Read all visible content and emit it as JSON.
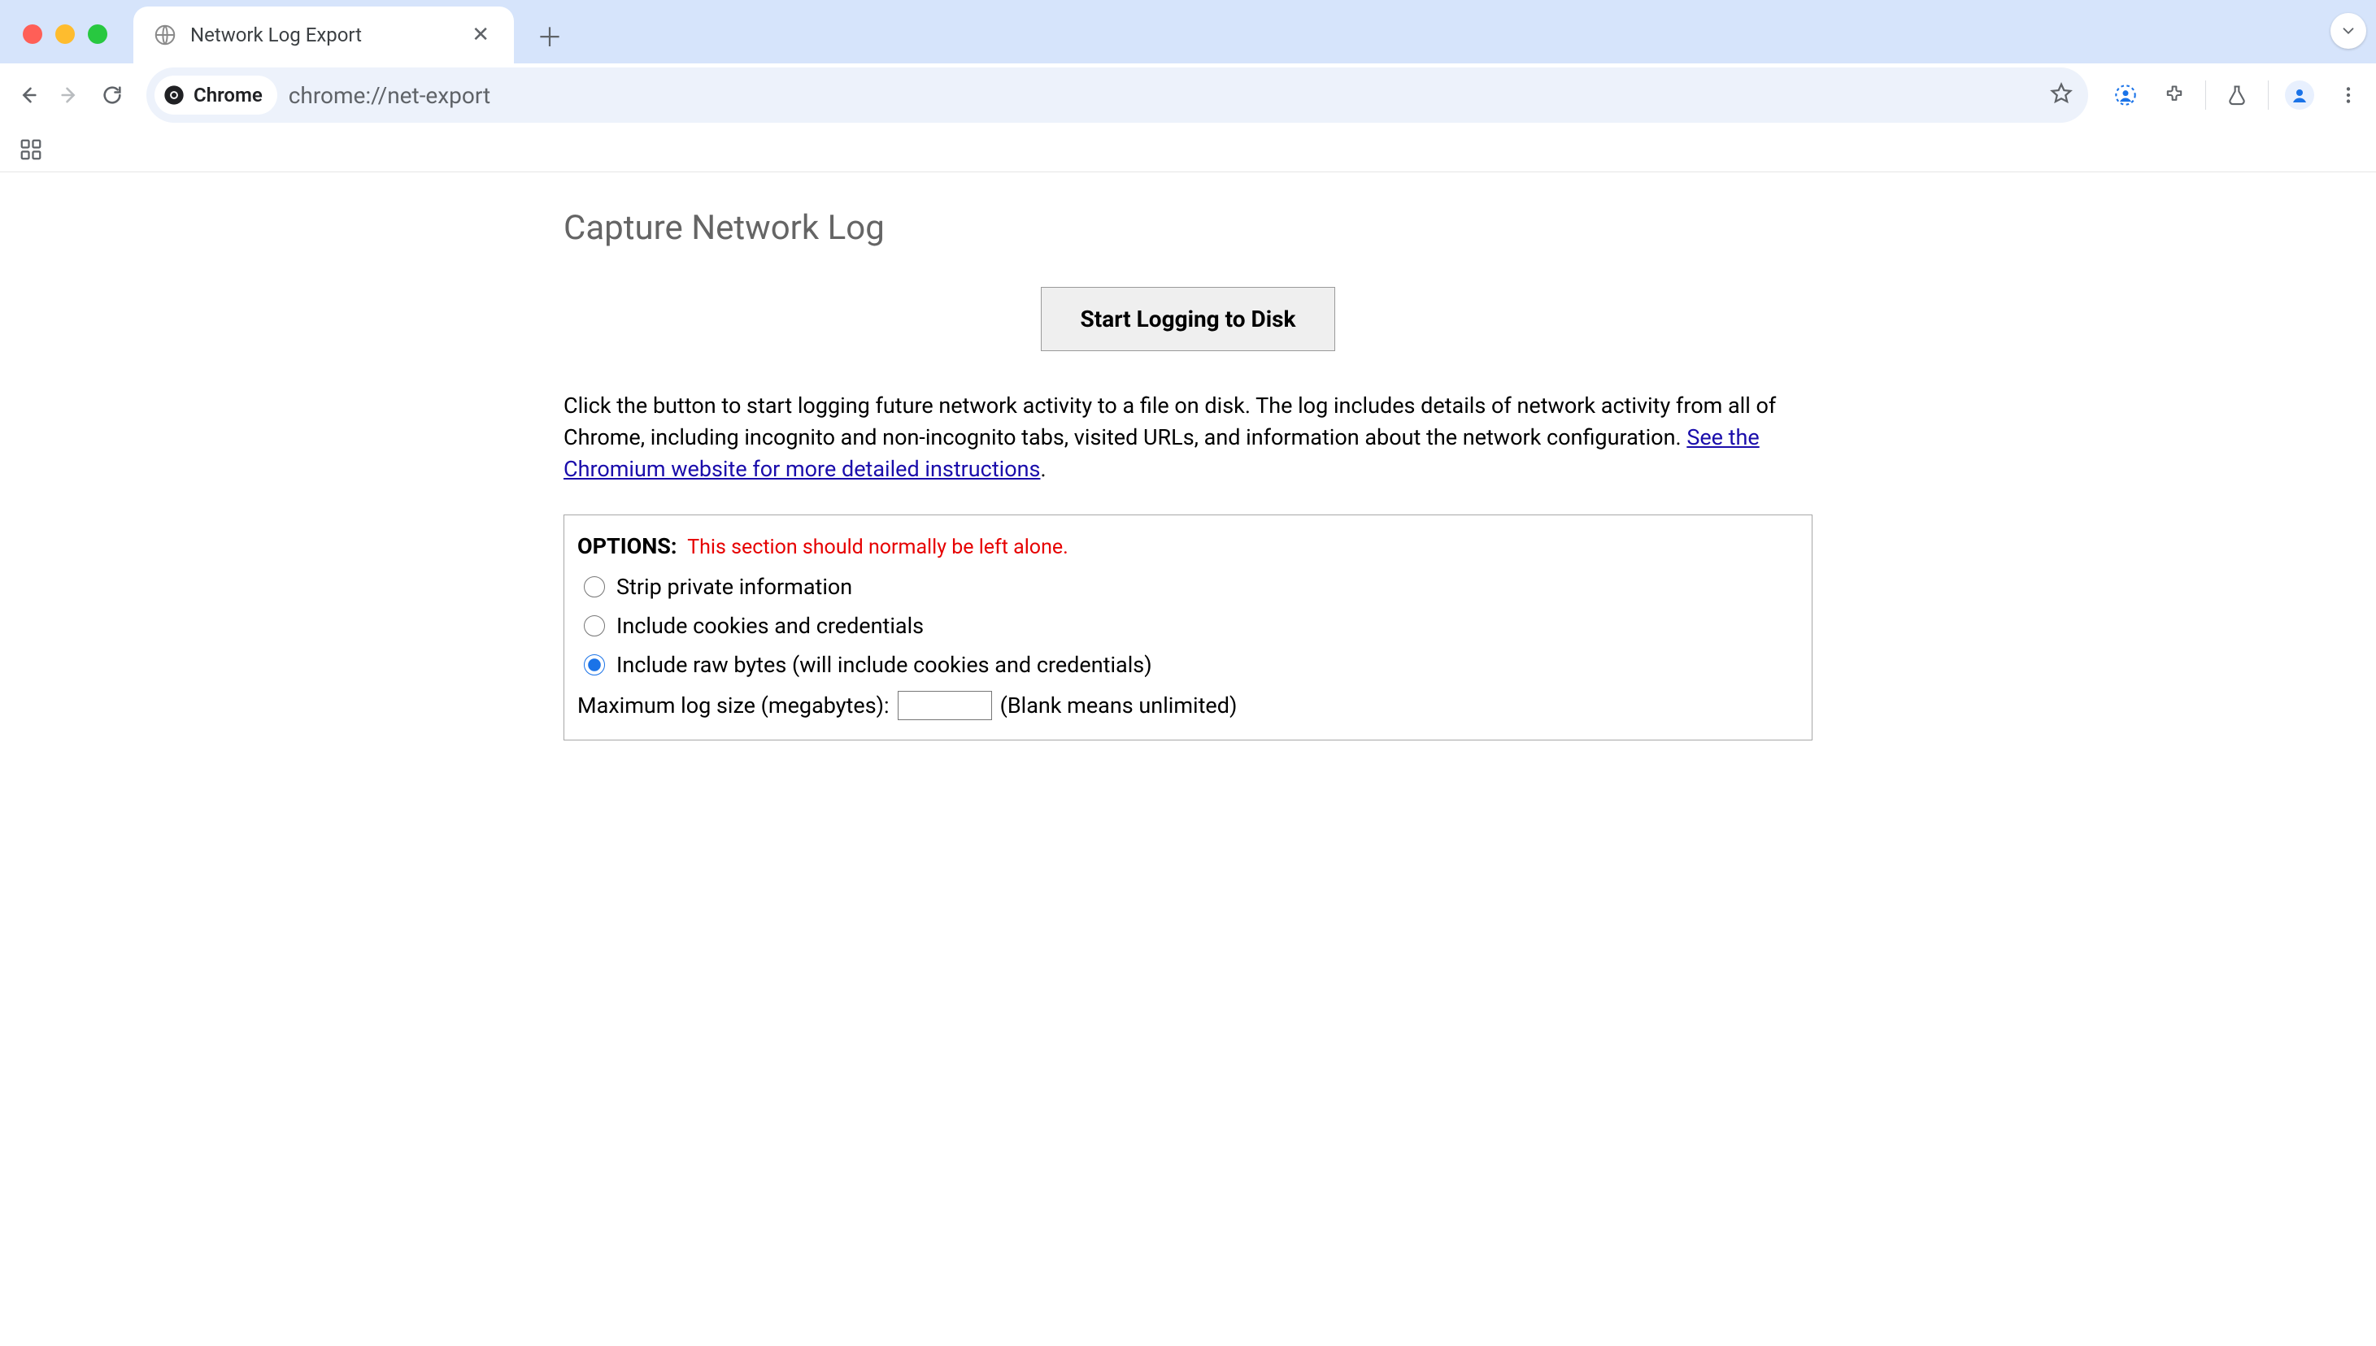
{
  "tab": {
    "title": "Network Log Export"
  },
  "omnibox": {
    "chip_label": "Chrome",
    "url": "chrome://net-export"
  },
  "page": {
    "title": "Capture Network Log",
    "start_button": "Start Logging to Disk",
    "description_1": "Click the button to start logging future network activity to a file on disk. The log includes details of network activity from all of Chrome, including incognito and non-incognito tabs, visited URLs, and information about the network configuration. ",
    "description_link": "See the Chromium website for more detailed instructions",
    "description_2": ".",
    "options": {
      "label": "OPTIONS:",
      "warn": "This section should normally be left alone.",
      "radios": [
        "Strip private information",
        "Include cookies and credentials",
        "Include raw bytes (will include cookies and credentials)"
      ],
      "selected_index": 2,
      "maxsize_label": "Maximum log size (megabytes): ",
      "maxsize_value": "",
      "maxsize_hint": "(Blank means unlimited)"
    }
  }
}
